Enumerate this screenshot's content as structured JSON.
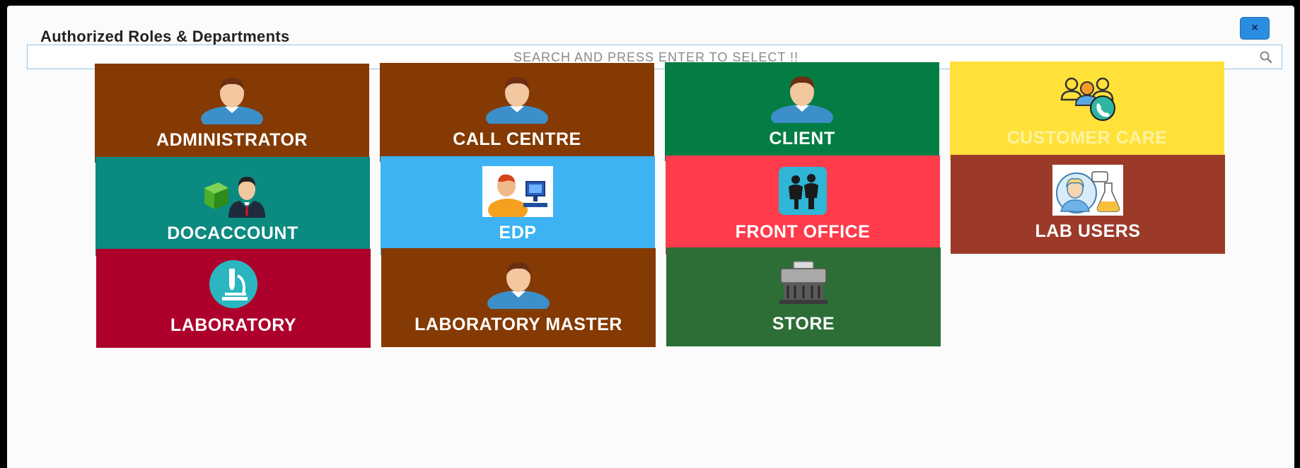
{
  "dialog": {
    "title": "Authorized Roles & Departments",
    "close_label": "×"
  },
  "search": {
    "placeholder": "SEARCH AND PRESS ENTER TO SELECT !!"
  },
  "colors": {
    "administrator": "#843a02",
    "call_centre": "#843a02",
    "client": "#047d44",
    "customer_care": "#ffe13a",
    "docaccount": "#0b8a80",
    "edp": "#3db3f4",
    "front_office": "#ff3b4c",
    "lab_users": "#9c3a2a",
    "laboratory": "#ad002b",
    "laboratory_master": "#843a02",
    "store": "#2d6d36"
  },
  "tiles": [
    {
      "label": "ADMINISTRATOR",
      "icon": "user-icon"
    },
    {
      "label": "CALL CENTRE",
      "icon": "user-icon"
    },
    {
      "label": "CLIENT",
      "icon": "user-icon"
    },
    {
      "label": "CUSTOMER CARE",
      "icon": "customer-care-icon"
    },
    {
      "label": "DOCACCOUNT",
      "icon": "doc-account-icon"
    },
    {
      "label": "EDP",
      "icon": "computer-operator-icon"
    },
    {
      "label": "FRONT OFFICE",
      "icon": "front-office-icon"
    },
    {
      "label": "LAB USERS",
      "icon": "lab-user-icon"
    },
    {
      "label": "LABORATORY",
      "icon": "microscope-icon"
    },
    {
      "label": "LABORATORY MASTER",
      "icon": "user-icon"
    },
    {
      "label": "STORE",
      "icon": "store-icon"
    }
  ]
}
